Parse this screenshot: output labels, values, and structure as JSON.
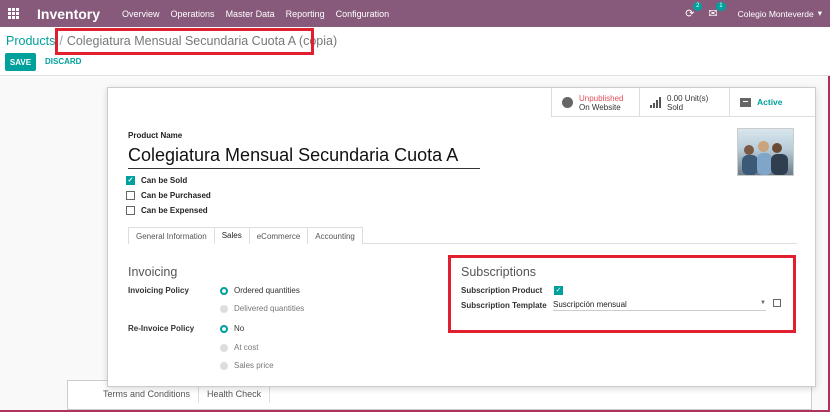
{
  "navbar": {
    "app_title": "Inventory",
    "menu": [
      "Overview",
      "Operations",
      "Master Data",
      "Reporting",
      "Configuration"
    ],
    "activity_count": "2",
    "messages_count": "1",
    "company": "Colegio Monteverde"
  },
  "breadcrumb": {
    "parent": "Products",
    "separator": "/",
    "current": "Colegiatura Mensual Secundaria Cuota A (copia)"
  },
  "actions": {
    "save": "SAVE",
    "discard": "DISCARD"
  },
  "smart_buttons": {
    "website_status": "Unpublished",
    "website_sub": "On Website",
    "sold_value": "0.00 Unit(s)",
    "sold_label": "Sold",
    "active_label": "Active"
  },
  "product": {
    "name_label": "Product Name",
    "name_value": "Colegiatura Mensual Secundaria Cuota A",
    "checkboxes": [
      {
        "label": "Can be Sold",
        "checked": true
      },
      {
        "label": "Can be Purchased",
        "checked": false
      },
      {
        "label": "Can be Expensed",
        "checked": false
      }
    ]
  },
  "tabs": [
    "General Information",
    "Sales",
    "eCommerce",
    "Accounting"
  ],
  "active_tab": "Sales",
  "invoicing": {
    "title": "Invoicing",
    "policy_label": "Invoicing Policy",
    "policy_options": [
      "Ordered quantities",
      "Delivered quantities"
    ],
    "policy_selected": "Ordered quantities",
    "reinvoice_label": "Re-Invoice Policy",
    "reinvoice_options": [
      "No",
      "At cost",
      "Sales price"
    ],
    "reinvoice_selected": "No"
  },
  "subscriptions": {
    "title": "Subscriptions",
    "product_label": "Subscription Product",
    "product_checked": true,
    "template_label": "Subscription Template",
    "template_value": "Suscripción mensual"
  },
  "bottom_tabs": [
    "Terms and Conditions",
    "Health Check"
  ],
  "colors": {
    "brand": "#875a7b",
    "accent": "#00a09d",
    "highlight": "#e0202e"
  }
}
